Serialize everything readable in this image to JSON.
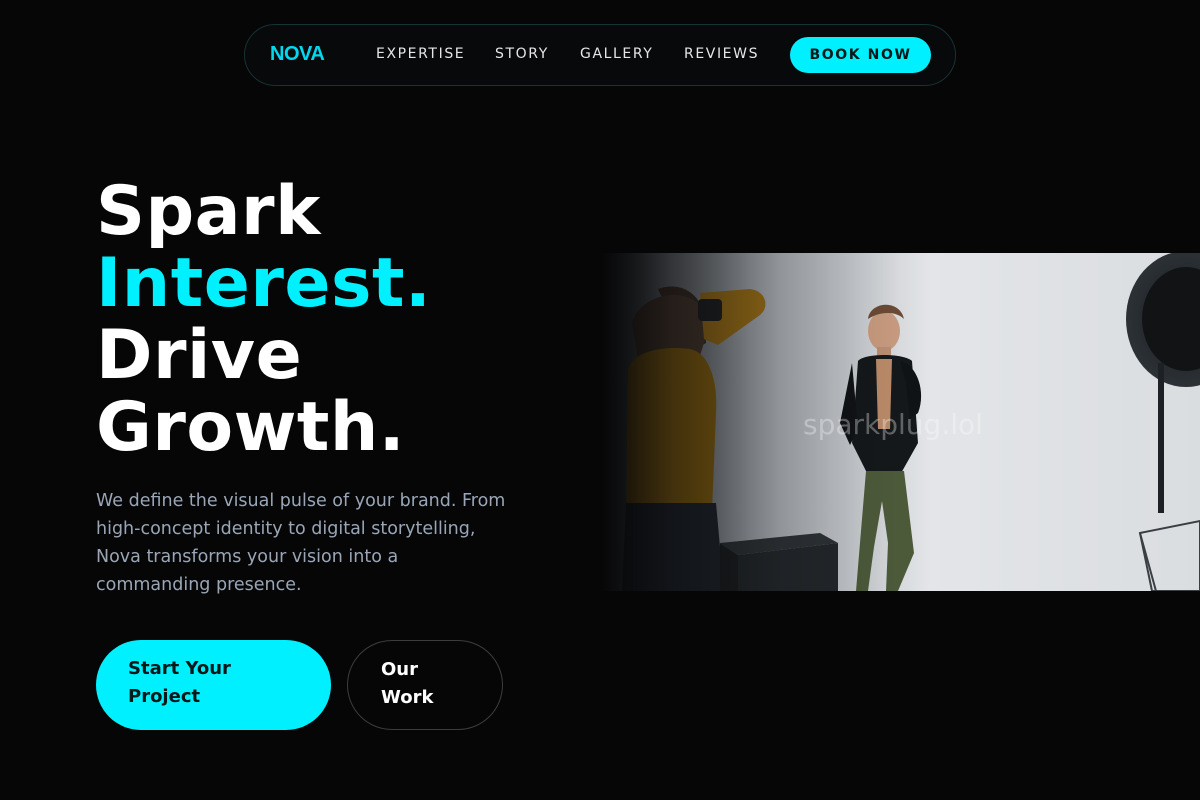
{
  "nav": {
    "brand": "NOVA",
    "links": [
      "EXPERTISE",
      "STORY",
      "GALLERY",
      "REVIEWS"
    ],
    "cta": "BOOK NOW"
  },
  "hero": {
    "headline": {
      "line1": "Spark",
      "line2": "Interest.",
      "line3": "Drive",
      "line4": "Growth."
    },
    "description": "We define the visual pulse of your brand. From high-concept identity to digital storytelling, Nova transforms your vision into a commanding presence.",
    "primary_button": "Start Your Project",
    "secondary_button": "Our Work",
    "image_watermark": "sparkplug.lol"
  },
  "colors": {
    "accent": "#00f0ff",
    "background": "#060607",
    "text": "#ffffff",
    "muted_text": "#9aa6b6"
  }
}
